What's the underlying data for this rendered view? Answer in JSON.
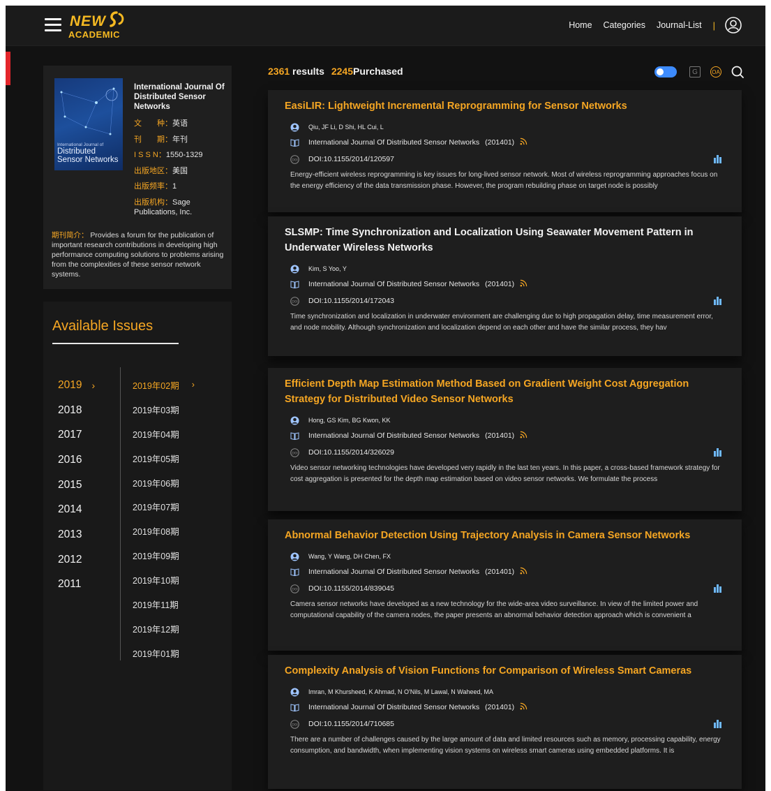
{
  "header": {
    "logo_new": "NEW",
    "logo_academic": "ACADEMIC",
    "nav": [
      {
        "label": "Home"
      },
      {
        "label": "Categories"
      },
      {
        "label": "Journal-List"
      }
    ],
    "nav_separator": "|"
  },
  "journal": {
    "cover_small": "International Journal of",
    "cover_big": "Distributed Sensor Networks",
    "title": "International Journal Of Distributed Sensor Networks",
    "meta": [
      {
        "key": "文　　种：",
        "value": "英语"
      },
      {
        "key": "刊　　期：",
        "value": "年刊"
      },
      {
        "key": "I S S N：",
        "value": "1550-1329"
      },
      {
        "key": "出版地区：",
        "value": "美国"
      },
      {
        "key": "出版频率：",
        "value": "1"
      }
    ],
    "publisher_key": "出版机构：",
    "publisher_value": "Sage Publications, Inc.",
    "intro_key": "期刊简介：",
    "intro_value": "Provides a forum for the publication of important research contributions in developing high performance computing solutions to problems arising from the complexities of these sensor network systems."
  },
  "issues": {
    "title": "Available Issues",
    "years": [
      "2019",
      "2018",
      "2017",
      "2016",
      "2015",
      "2014",
      "2013",
      "2012",
      "2011"
    ],
    "active_year": "2019",
    "chevron": "›",
    "months": [
      "2019年02期",
      "2019年03期",
      "2019年04期",
      "2019年05期",
      "2019年06期",
      "2019年07期",
      "2019年08期",
      "2019年09期",
      "2019年10期",
      "2019年11期",
      "2019年12期",
      "2019年01期"
    ],
    "active_month": "2019年02期"
  },
  "results": {
    "count": "2361",
    "count_label": "results",
    "purchased": "2245",
    "purchased_label": "Purchased"
  },
  "toolbar": {
    "g_label": "G",
    "oa_label": "OA"
  },
  "articles": [
    {
      "title": "EasiLIR: Lightweight Incremental Reprogramming for Sensor Networks",
      "title_color": "#f5a623",
      "authors": "Qiu, JF  Li, D  Shi, HL  Cui, L",
      "journal": "International Journal Of Distributed Sensor Networks",
      "year": "(201401)",
      "doi": "DOI:10.1155/2014/120597",
      "abstract": "Energy-efficient wireless reprogramming is key issues for long-lived sensor network. Most of wireless reprogramming approaches focus on the energy efficiency of the data transmission phase. However, the program rebuilding phase on target node is possibly"
    },
    {
      "title": "SLSMP: Time Synchronization and Localization Using Seawater Movement Pattern in Underwater Wireless Networks",
      "title_color": "#f2f2f2",
      "authors": "Kim, S  Yoo, Y",
      "journal": "International Journal Of Distributed Sensor Networks",
      "year": "(201401)",
      "doi": "DOI:10.1155/2014/172043",
      "abstract": "Time synchronization and localization in underwater environment are challenging due to high propagation delay, time measurement error, and node mobility. Although synchronization and localization depend on each other and have the similar process, they hav"
    },
    {
      "title": "Efficient Depth Map Estimation Method Based on Gradient Weight Cost Aggregation Strategy for Distributed Video Sensor Networks",
      "title_color": "#f5a623",
      "authors": "Hong, GS  Kim, BG  Kwon, KK",
      "journal": "International Journal Of Distributed Sensor Networks",
      "year": "(201401)",
      "doi": "DOI:10.1155/2014/326029",
      "abstract": "Video sensor networking technologies have developed very rapidly in the last ten years. In this paper, a cross-based framework strategy for cost aggregation is presented for the depth map estimation based on video sensor networks. We formulate the process"
    },
    {
      "title": "Abnormal Behavior Detection Using Trajectory Analysis in Camera Sensor Networks",
      "title_color": "#f5a623",
      "authors": "Wang, Y  Wang, DH  Chen, FX",
      "journal": "International Journal Of Distributed Sensor Networks",
      "year": "(201401)",
      "doi": "DOI:10.1155/2014/839045",
      "abstract": "Camera sensor networks have developed as a new technology for the wide-area video surveillance. In view of the limited power and computational capability of the camera nodes, the paper presents an abnormal behavior detection approach which is convenient a"
    },
    {
      "title": "Complexity Analysis of Vision Functions for Comparison of Wireless Smart Cameras",
      "title_color": "#f5a623",
      "authors": "Imran, M  Khursheed, K  Ahmad, N  O'Nils, M  Lawal, N  Waheed, MA",
      "journal": "International Journal Of Distributed Sensor Networks",
      "year": "(201401)",
      "doi": "DOI:10.1155/2014/710685",
      "abstract": "There are a number of challenges caused by the large amount of data and limited resources such as memory, processing capability, energy consumption, and bandwidth, when implementing vision systems on wireless smart cameras using embedded platforms. It is"
    }
  ],
  "colors": {
    "accent": "#f5a623",
    "background": "#121212",
    "card": "#1e1e1e",
    "toggle": "#3d8bfd",
    "stats_icon": "#6fb9ff",
    "red_marker": "#e3262b"
  },
  "icons": [
    "hamburger-menu-icon",
    "user-icon",
    "g-icon",
    "oa-icon",
    "search-icon",
    "author-icon",
    "book-icon",
    "doi-icon",
    "rss-icon",
    "stats-icon",
    "chevron-right-icon"
  ]
}
